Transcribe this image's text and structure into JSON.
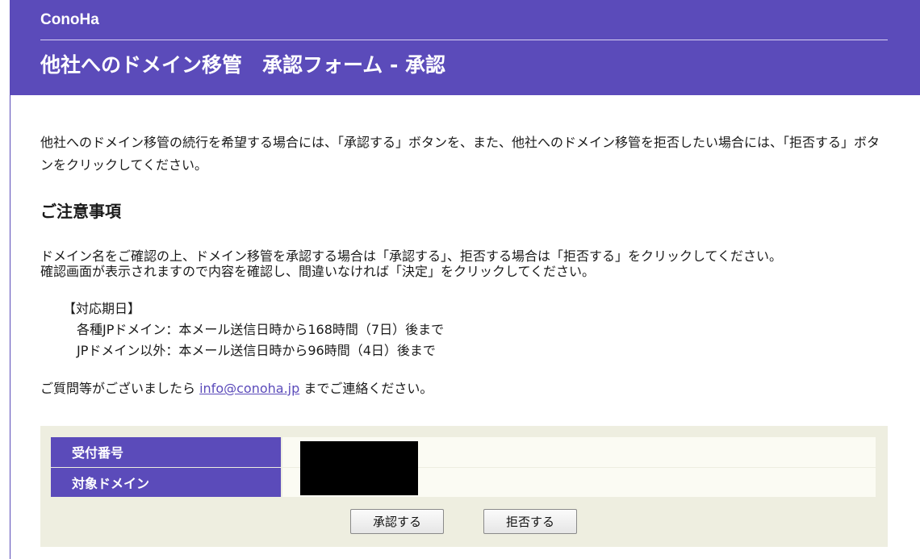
{
  "header": {
    "brand": "ConoHa",
    "title": "他社へのドメイン移管　承認フォーム - 承認"
  },
  "intro": "他社へのドメイン移管の続行を希望する場合には、「承認する」ボタンを、また、他社へのドメイン移管を拒否したい場合には、「拒否する」ボタンをクリックしてください。",
  "notice": {
    "heading": "ご注意事項",
    "line1": "ドメイン名をご確認の上、ドメイン移管を承認する場合は「承認する」、拒否する場合は「拒否する」をクリックしてください。",
    "line2": "確認画面が表示されますので内容を確認し、間違いなければ「決定」をクリックしてください。"
  },
  "deadline": {
    "label": "【対応期日】",
    "jp": "各種JPドメイン：本メール送信日時から168時間（7日）後まで",
    "non_jp": "JPドメイン以外：本メール送信日時から96時間（4日）後まで"
  },
  "contact": {
    "prefix": "ご質問等がございましたら ",
    "email": "info@conoha.jp",
    "suffix": " までご連絡ください。"
  },
  "form": {
    "receipt_label": "受付番号",
    "domain_label": "対象ドメイン",
    "approve_button": "承認する",
    "reject_button": "拒否する"
  },
  "colors": {
    "brand_purple": "#5b4bba",
    "panel_bg": "#eeeee0"
  }
}
